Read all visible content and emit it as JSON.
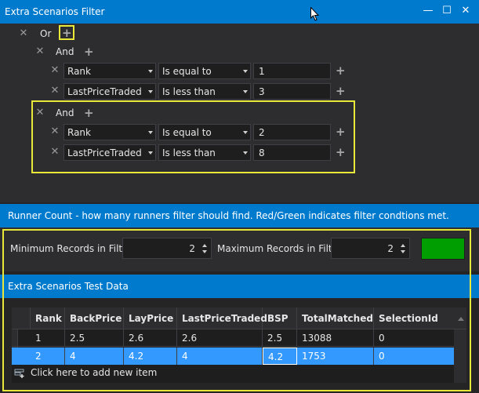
{
  "window": {
    "title": "Extra Scenarios Filter",
    "minimize_glyph": "—",
    "maximize_glyph": "☐",
    "close_glyph": "✕"
  },
  "filter": {
    "root_operator": "Or",
    "groups": [
      {
        "operator": "And",
        "conditions": [
          {
            "field": "Rank",
            "comparison": "Is equal to",
            "value": "1"
          },
          {
            "field": "LastPriceTraded",
            "comparison": "Is less than",
            "value": "3"
          }
        ]
      },
      {
        "operator": "And",
        "conditions": [
          {
            "field": "Rank",
            "comparison": "Is equal to",
            "value": "2"
          },
          {
            "field": "LastPriceTraded",
            "comparison": "Is less than",
            "value": "8"
          }
        ]
      }
    ]
  },
  "runner_count": {
    "header": "Runner Count - how many runners filter should find. Red/Green indicates filter condtions met.",
    "min_label": "Minimum Records in Filter:",
    "min_value": "2",
    "max_label": "Maximum Records in Filter:",
    "max_value": "2",
    "status_color": "#009e00"
  },
  "test_data": {
    "header": "Extra Scenarios Test Data",
    "columns": [
      "Rank",
      "BackPrice",
      "LayPrice",
      "LastPriceTraded",
      "BSP",
      "TotalMatched",
      "SelectionId"
    ],
    "rows": [
      [
        "1",
        "2.5",
        "2.6",
        "2.6",
        "2.5",
        "13088",
        "0"
      ],
      [
        "2",
        "4",
        "4.2",
        "4",
        "4.2",
        "1753",
        "0"
      ]
    ],
    "add_row_text": "Click here to add new item"
  },
  "colors": {
    "accent": "#007acc",
    "highlight": "#e8e83a",
    "selection": "#3399ff"
  }
}
